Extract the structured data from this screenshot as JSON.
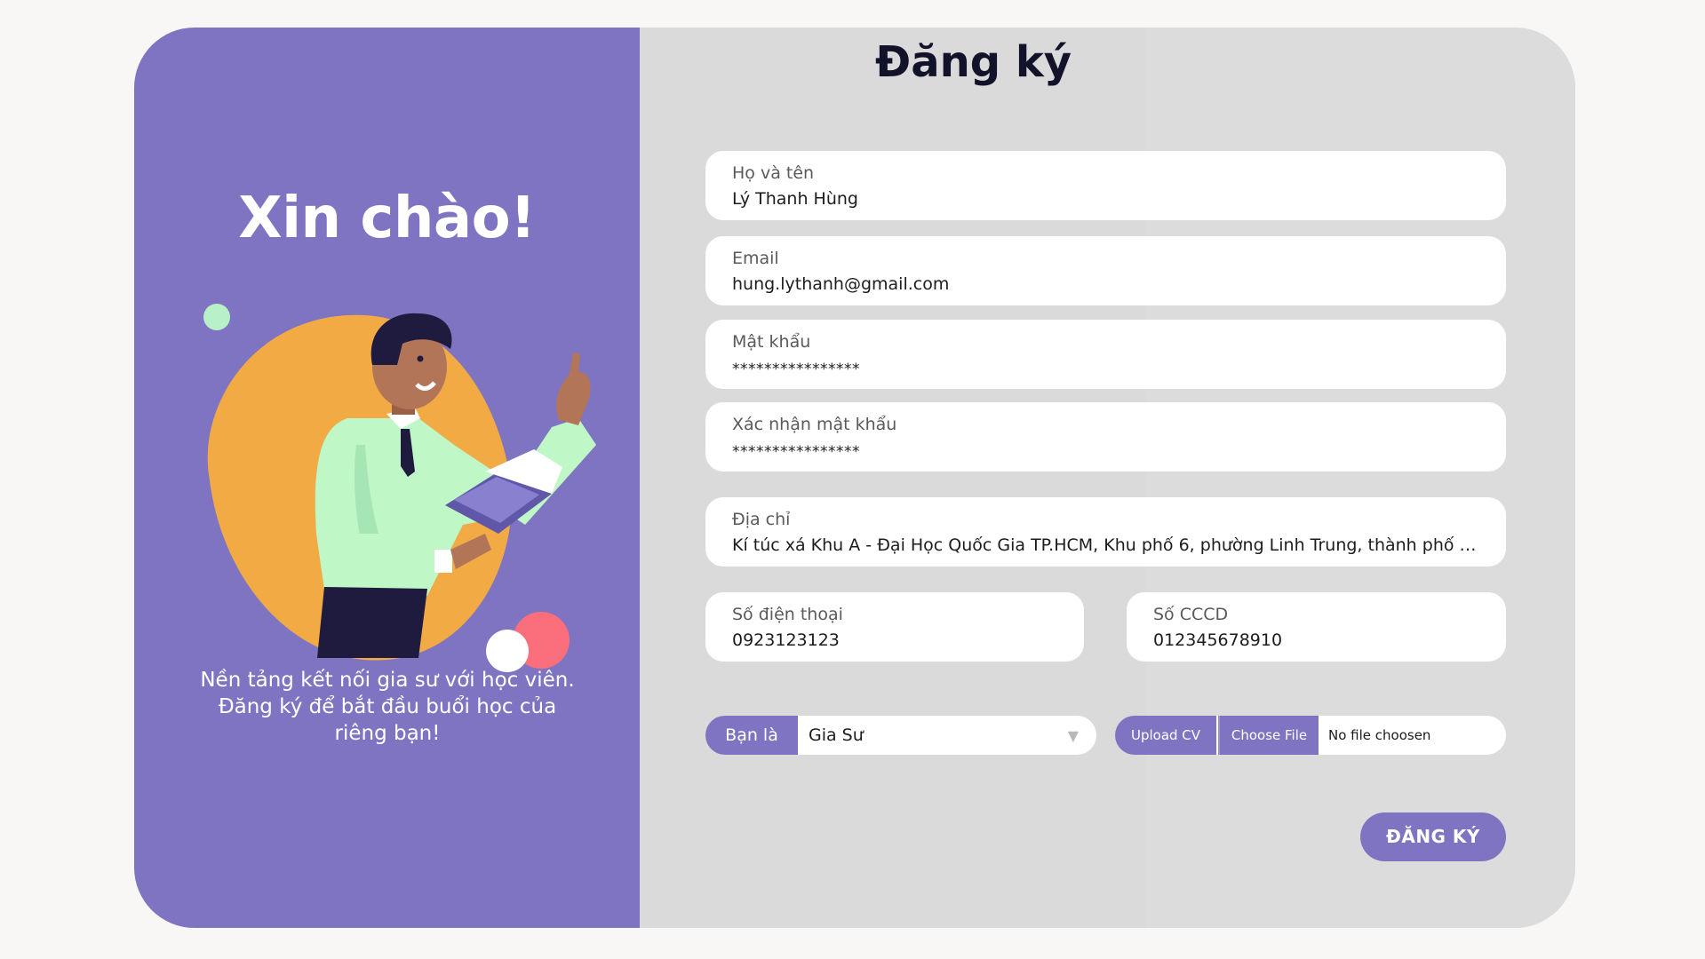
{
  "left_panel": {
    "greeting": "Xin chào!",
    "tagline_lines": [
      "Nền tảng kết nối gia sư với học viên.",
      "Đăng ký để bắt đầu buổi học của",
      "riêng bạn!"
    ],
    "accent_color": "#7f74c1"
  },
  "form": {
    "title": "Đăng ký",
    "fields": {
      "full_name": {
        "label": "Họ và tên",
        "value": "Lý Thanh Hùng"
      },
      "email": {
        "label": "Email",
        "value": "hung.lythanh@gmail.com"
      },
      "password": {
        "label": "Mật khẩu",
        "value": "****************"
      },
      "confirm_password": {
        "label": "Xác nhận mật khẩu",
        "value": "****************"
      },
      "address": {
        "label": "Địa chỉ",
        "value": "Kí túc xá Khu A - Đại Học Quốc Gia TP.HCM, Khu phố 6, phường Linh Trung, thành phố Th..."
      },
      "phone": {
        "label": "Số điện thoại",
        "value": "0923123123"
      },
      "id_number": {
        "label": "Số CCCD",
        "value": "012345678910"
      }
    },
    "role": {
      "label": "Bạn là",
      "selected": "Gia Sư"
    },
    "upload": {
      "label": "Upload CV",
      "choose_label": "Choose File",
      "status": "No file choosen"
    },
    "submit_label": "ĐĂNG KÝ"
  }
}
